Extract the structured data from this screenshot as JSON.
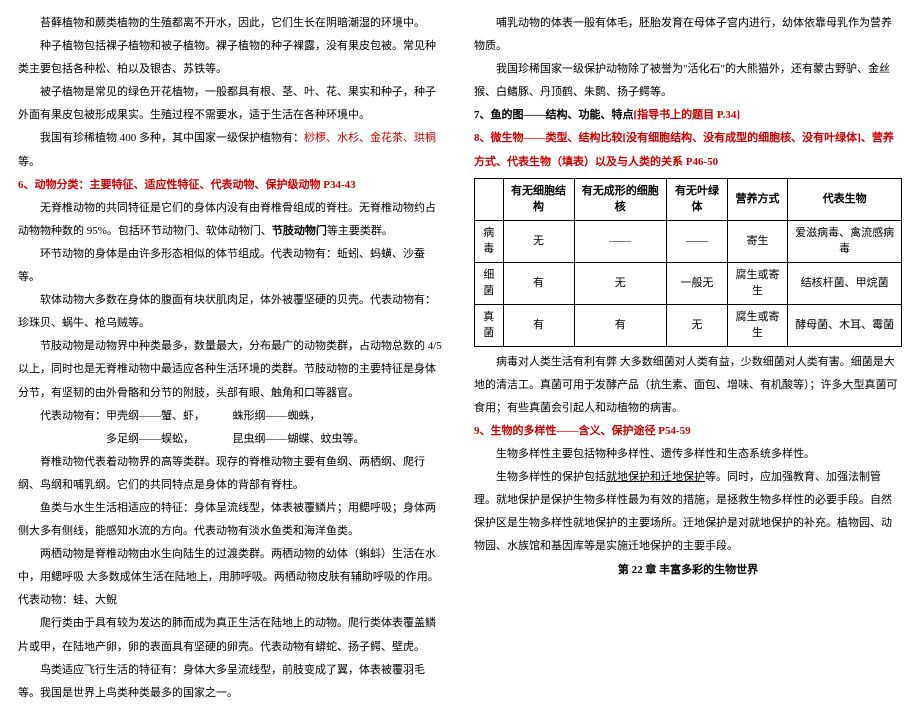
{
  "left": {
    "p1": "苔藓植物和蕨类植物的生殖都离不开水，因此，它们生长在阴暗潮湿的环境中。",
    "p2": "种子植物包括裸子植物和被子植物。裸子植物的种子裸露，没有果皮包被。常见种类主要包括各种松、柏以及银杏、苏铁等。",
    "p3": "被子植物是常见的绿色开花植物，一般都具有根、茎、叶、花、果实和种子，种子外面有果皮包被形成果实。生殖过程不需要水，适于生活在各种环境中。",
    "p4a": "我国有珍稀植物 400 多种，其中国家一级保护植物有：",
    "p4b": "桫椤、水杉、金花茶、珙桐",
    "p4c": "等。",
    "h6": "6、动物分类：主要特征、适应性特征、代表动物、保护级动物 P34-43",
    "p5a": "无脊椎动物的共同特征是它们的身体内没有由脊椎骨组成的脊柱。无脊椎动物约占动物物种数的 95%。包括环节动物门、软体动物门、",
    "p5b": "节肢动物门",
    "p5c": "等主要类群。",
    "p6": "环节动物的身体是由许多形态相似的体节组成。代表动物有：蚯蚓、蚂蟥、沙蚕等。",
    "p7": "软体动物大多数在身体的腹面有块状肌肉足，体外被覆坚硬的贝壳。代表动物有：珍珠贝、蜗牛、枪乌贼等。",
    "p8": "节肢动物是动物界中种类最多，数量最大，分布最广的动物类群，占动物总数的 4/5 以上，同时也是无脊椎动物中最适应各种生活环境的类群。节肢动物的主要特征是身体分节，有坚韧的由外骨骼和分节的附肢，头部有眼、触角和口等器官。",
    "p9": "代表动物有：甲壳纲——蟹、虾，　　　蛛形纲——蜘蛛，",
    "p10": "　　　　　　多足纲——蜈蚣，　　　　昆虫纲——蝴蝶、蚊虫等。",
    "p11": "脊椎动物代表着动物界的高等类群。现存的脊椎动物主要有鱼纲、两栖纲、爬行纲、鸟纲和哺乳纲。它们的共同特点是身体的背部有脊柱。",
    "p12": "鱼类与水生生活相适应的特征：身体呈流线型，体表被覆鳞片；用鳃呼吸；身体两侧大多有侧线，能感知水流的方向。代表动物有淡水鱼类和海洋鱼类。",
    "p13": "两栖动物是脊椎动物由水生向陆生的过渡类群。两栖动物的幼体（蝌蚪）生活在水中，用鳃呼吸 大多数成体生活在陆地上，用肺呼吸。两栖动物皮肤有辅助呼吸的作用。代表动物：蛙、大鲵",
    "p14": "爬行类由于具有较为发达的肺而成为真正生活在陆地上的动物。爬行类体表覆盖鳞片或甲，在陆地产卵，卵的表面具有坚硬的卵壳。代表动物有蟒蛇、扬子鳄、壁虎。",
    "p15": "鸟类适应飞行生活的特征有：身体大多呈流线型，前肢变成了翼，体表被覆羽毛等。我国是世界上鸟类种类最多的国家之一。"
  },
  "right": {
    "p1": "哺乳动物的体表一般有体毛，胚胎发育在母体子宫内进行，幼体依靠母乳作为营养物质。",
    "p2": "我国珍稀国家一级保护动物除了被誉为\"活化石\"的大熊猫外，还有蒙古野驴、金丝猴、白鳍豚、丹顶鹤、朱鹮、扬子鳄等。",
    "h7a": "7、鱼的图——结构、功能、特点",
    "h7b": "[指导书上的题目 P.34]",
    "h8": "8、微生物——类型、结构比较[没有细胞结构、没有成型的细胞核、没有叶绿体]、营养方式、代表生物（填表）以及与人类的关系 P46-50",
    "table": {
      "head": [
        "",
        "有无细胞结构",
        "有无成形的细胞核",
        "有无叶绿体",
        "营养方式",
        "代表生物"
      ],
      "rows": [
        [
          "病毒",
          "无",
          "——",
          "——",
          "寄生",
          "爱滋病毒、禽流感病毒"
        ],
        [
          "细菌",
          "有",
          "无",
          "一般无",
          "腐生或寄生",
          "结核杆菌、甲烷菌"
        ],
        [
          "真菌",
          "有",
          "有",
          "无",
          "腐生或寄生",
          "酵母菌、木耳、霉菌"
        ]
      ]
    },
    "p3": "病毒对人类生活有利有弊 大多数细菌对人类有益，少数细菌对人类有害。细菌是大地的清洁工。真菌可用于发酵产品（抗生素、面包、增味、有机酸等）；许多大型真菌可食用；有些真菌会引起人和动植物的病害。",
    "h9": "9、生物的多样性——含义、保护途径 P54-59",
    "p4": "生物多样性主要包括物种多样性、遗传多样性和生态系统多样性。",
    "p5a": "生物多样性的保护包括",
    "p5b": "就地保护和迁地保护",
    "p5c": "等。同时，应加强教育、加强法制管理。就地保护是保护生物多样性最为有效的措施，是拯救生物多样性的必要手段。自然保护区是生物多样性就地保护的主要场所。迁地保护是对就地保护的补充。植物园、动物园、水族馆和基因库等是实施迁地保护的主要手段。",
    "ch22": "第 22 章 丰富多彩的生物世界"
  }
}
